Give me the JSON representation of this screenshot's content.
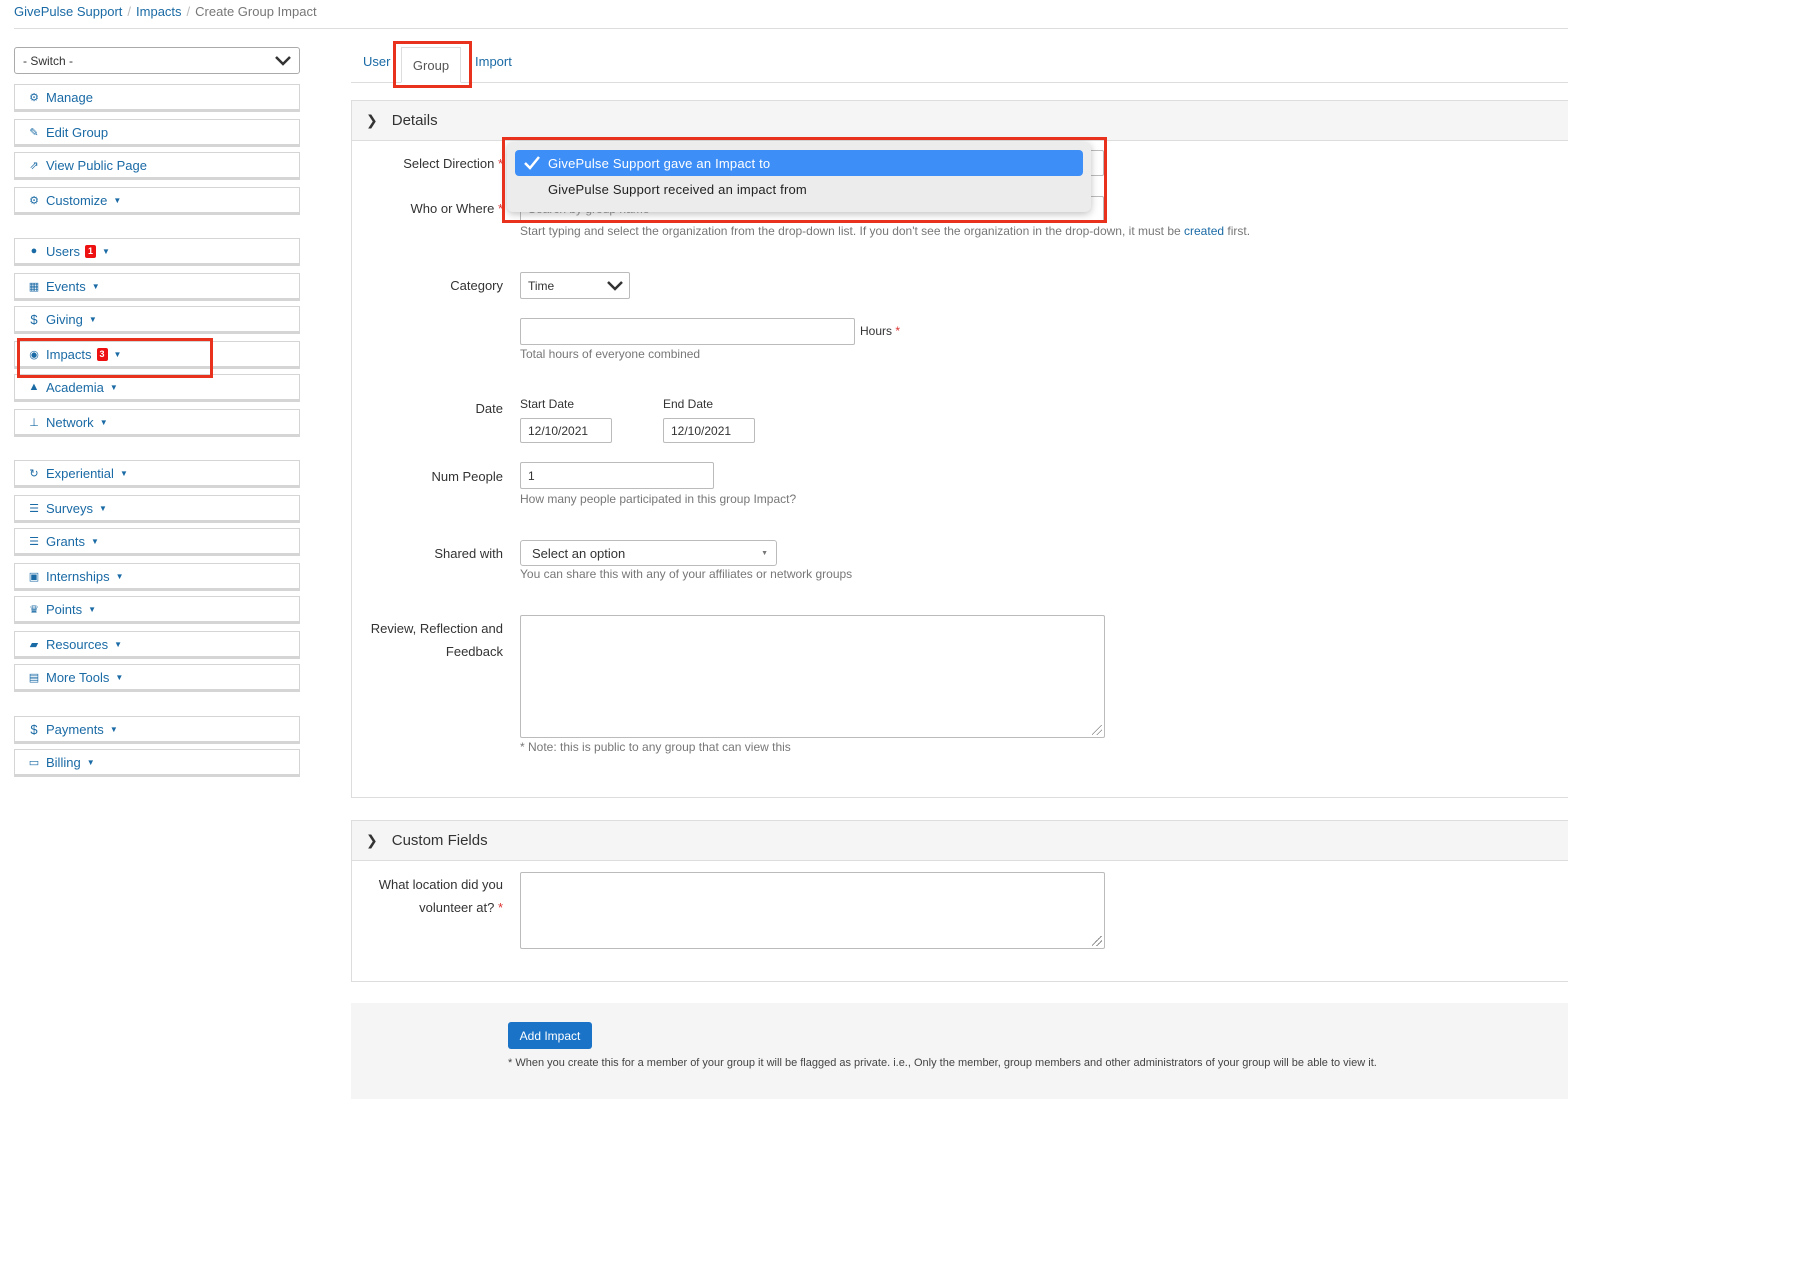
{
  "breadcrumb": {
    "items": [
      "GivePulse Support",
      "Impacts",
      "Create Group Impact"
    ],
    "separator": "/"
  },
  "sidebar": {
    "switch_label": "- Switch -",
    "manage": "Manage",
    "edit_group": "Edit Group",
    "view_public_page": "View Public Page",
    "customize": "Customize",
    "users": "Users",
    "users_badge": "1",
    "events": "Events",
    "giving": "Giving",
    "impacts": "Impacts",
    "impacts_badge": "3",
    "academia": "Academia",
    "network": "Network",
    "experiential": "Experiential",
    "surveys": "Surveys",
    "grants": "Grants",
    "internships": "Internships",
    "points": "Points",
    "resources": "Resources",
    "more_tools": "More Tools",
    "payments": "Payments",
    "billing": "Billing"
  },
  "tabs": {
    "user": "User",
    "group": "Group",
    "import": "Import"
  },
  "details": {
    "title": "Details",
    "select_direction_label": "Select Direction",
    "direction_options": [
      "GivePulse Support gave an Impact to",
      "GivePulse Support received an impact from"
    ],
    "who_where_label": "Who or Where",
    "who_where_placeholder": "Search by group name",
    "who_where_help_pre": "Start typing and select the organization from the drop-down list. If you don't see the organization in the drop-down, it must be ",
    "who_where_help_link": "created",
    "who_where_help_post": " first.",
    "category_label": "Category",
    "category_value": "Time",
    "hours_label": "Hours",
    "hours_value": "",
    "hours_help": "Total hours of everyone combined",
    "date_label": "Date",
    "start_date_label": "Start Date",
    "start_date_value": "12/10/2021",
    "end_date_label": "End Date",
    "end_date_value": "12/10/2021",
    "num_people_label": "Num People",
    "num_people_value": "1",
    "num_people_help": "How many people participated in this group Impact?",
    "shared_with_label": "Shared with",
    "shared_with_value": "Select an option",
    "shared_with_help": "You can share this with any of your affiliates or network groups",
    "review_label_1": "Review, Reflection and",
    "review_label_2": "Feedback",
    "review_value": "",
    "review_help": "* Note: this is public to any group that can view this"
  },
  "custom_fields": {
    "title": "Custom Fields",
    "location_label_1": "What location did you",
    "location_label_2": "volunteer at?",
    "location_value": ""
  },
  "footer": {
    "add_button": "Add Impact",
    "note": "* When you create this for a member of your group it will be flagged as private. i.e., Only the member, group members and other administrators of your group will be able to view it."
  },
  "colors": {
    "link": "#1a6aa5",
    "highlight": "#e8321e",
    "primary_button": "#1a73c7",
    "dropdown_selected": "#3d8ef6"
  }
}
